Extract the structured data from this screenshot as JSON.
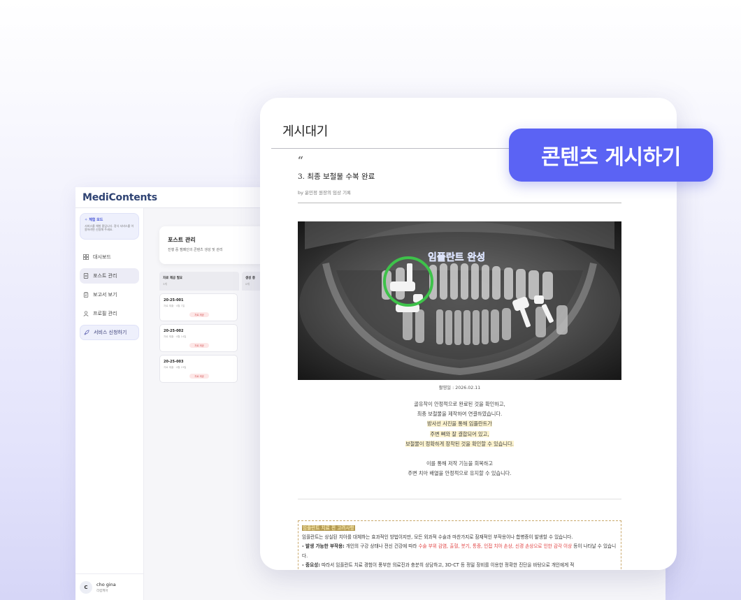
{
  "app": {
    "logo": "MediContents"
  },
  "trial": {
    "title": "체험 모드",
    "desc": "서비스를 체험 중입니다. 정식 서비스를 이용하려면 신청해 주세요."
  },
  "sidebar": {
    "items": [
      {
        "label": "대시보드",
        "icon": "dashboard-icon"
      },
      {
        "label": "포스트 관리",
        "icon": "document-icon",
        "active": true
      },
      {
        "label": "보고서 보기",
        "icon": "report-icon"
      },
      {
        "label": "프로필 관리",
        "icon": "user-icon"
      },
      {
        "label": "서비스 신청하기",
        "icon": "rocket-icon"
      }
    ]
  },
  "user": {
    "initial": "C",
    "name": "cho gina",
    "role": "리컴케어"
  },
  "post_manage": {
    "title": "포스트 관리",
    "subtitle": "진행 중 캠페인의 콘텐츠 생성 및 관리",
    "columns": [
      {
        "title": "자료 제공 필요",
        "count": "3개"
      },
      {
        "title": "생성 중",
        "count": "0개"
      }
    ],
    "tasks": [
      {
        "id": "20-25-001",
        "sub": "자료 제출 · 4월 7일",
        "badge": "자료 제공"
      },
      {
        "id": "20-25-002",
        "sub": "자료 제출 · 4월 14일",
        "badge": "자료 제공"
      },
      {
        "id": "20-25-003",
        "sub": "자료 제출 · 4월 19일",
        "badge": "자료 제공"
      }
    ]
  },
  "card": {
    "title": "게시대기",
    "quote": "“",
    "article_title": "3. 최종 보철물 수복 완료",
    "byline": "by 윤민정 원장의 임상 기록",
    "xray_label": "임플란트 완성",
    "caption": "촬영일 : 2026.02.11",
    "lines": [
      "골유착이 안정적으로 완료된 것을 확인하고,",
      "최종 보철물을 제작하여 연결하였습니다.",
      "방사선 사진을 통해 임플란트가",
      "주변 뼈와 잘 결합되어 있고,",
      "보철물이 정확하게 장착된 것을 확인할 수 있습니다.",
      "이를 통해 저작 기능을 회복하고",
      "주변 치아 배열을 안정적으로 유지할 수 있습니다."
    ],
    "notice": {
      "title": "임플란트 치료 전 고려사항",
      "intro": "임플란트는 상실된 치아를 대체하는 효과적인 방법이지만, 모든 외과적 수술과 마찬가지로 잠재적인 부작용이나 합병증이 발생할 수 있습니다.",
      "side_label": "- 발생 가능한 부작용:",
      "side_text": " 개인의 구강 상태나 전신 건강에 따라 ",
      "side_red": "수술 부위 감염, 출혈, 붓기, 통증, 인접 치아 손상, 신경 손상으로 인한 감각 이상",
      "side_end": " 등이 나타날 수 있습니다.",
      "imp_label": "- 중요성:",
      "imp_text": " 따라서 임플란트 치료 경험이 풍부한 의료진과 충분히 상담하고, 3D-CT 등 정밀 장비를 이용한 정확한 진단을 바탕으로 개인에게 적"
    }
  },
  "cta": {
    "label": "콘텐츠 게시하기"
  },
  "colors": {
    "accent": "#5b63f4",
    "logo": "#2f4373",
    "highlight": "#fcf3cf",
    "warning": "#e04040"
  }
}
